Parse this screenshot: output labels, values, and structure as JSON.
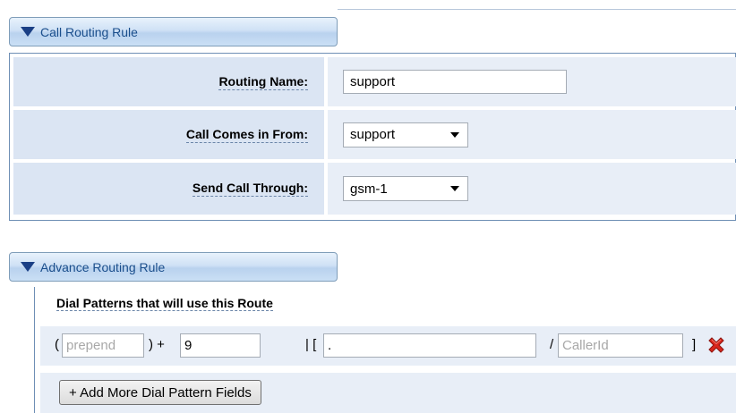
{
  "call_routing": {
    "header": "Call Routing Rule",
    "routing_name": {
      "label": "Routing Name:",
      "value": "support"
    },
    "call_comes_from": {
      "label": "Call Comes in From:",
      "value": "support"
    },
    "send_call_through": {
      "label": "Send Call Through:",
      "value": "gsm-1"
    }
  },
  "advance_routing": {
    "header": "Advance Routing Rule",
    "dial_patterns_title": "Dial Patterns that will use this Route",
    "pattern": {
      "open_paren": "(",
      "prepend_placeholder": "prepend",
      "close_plus": ") +",
      "prefix_value": "9",
      "bracket_sep": "| [",
      "match_value": ".",
      "slash": "/",
      "callerid_placeholder": "CallerId",
      "close_bracket": "]"
    },
    "add_button_label": "+ Add More Dial Pattern Fields"
  },
  "icons": {
    "collapse": "collapse-triangle-icon",
    "delete": "delete-x-icon"
  },
  "colors": {
    "accent": "#1a4e8c",
    "label_bg": "#dbe5f3",
    "value_bg": "#e8eef7",
    "delete": "#d9261c"
  }
}
